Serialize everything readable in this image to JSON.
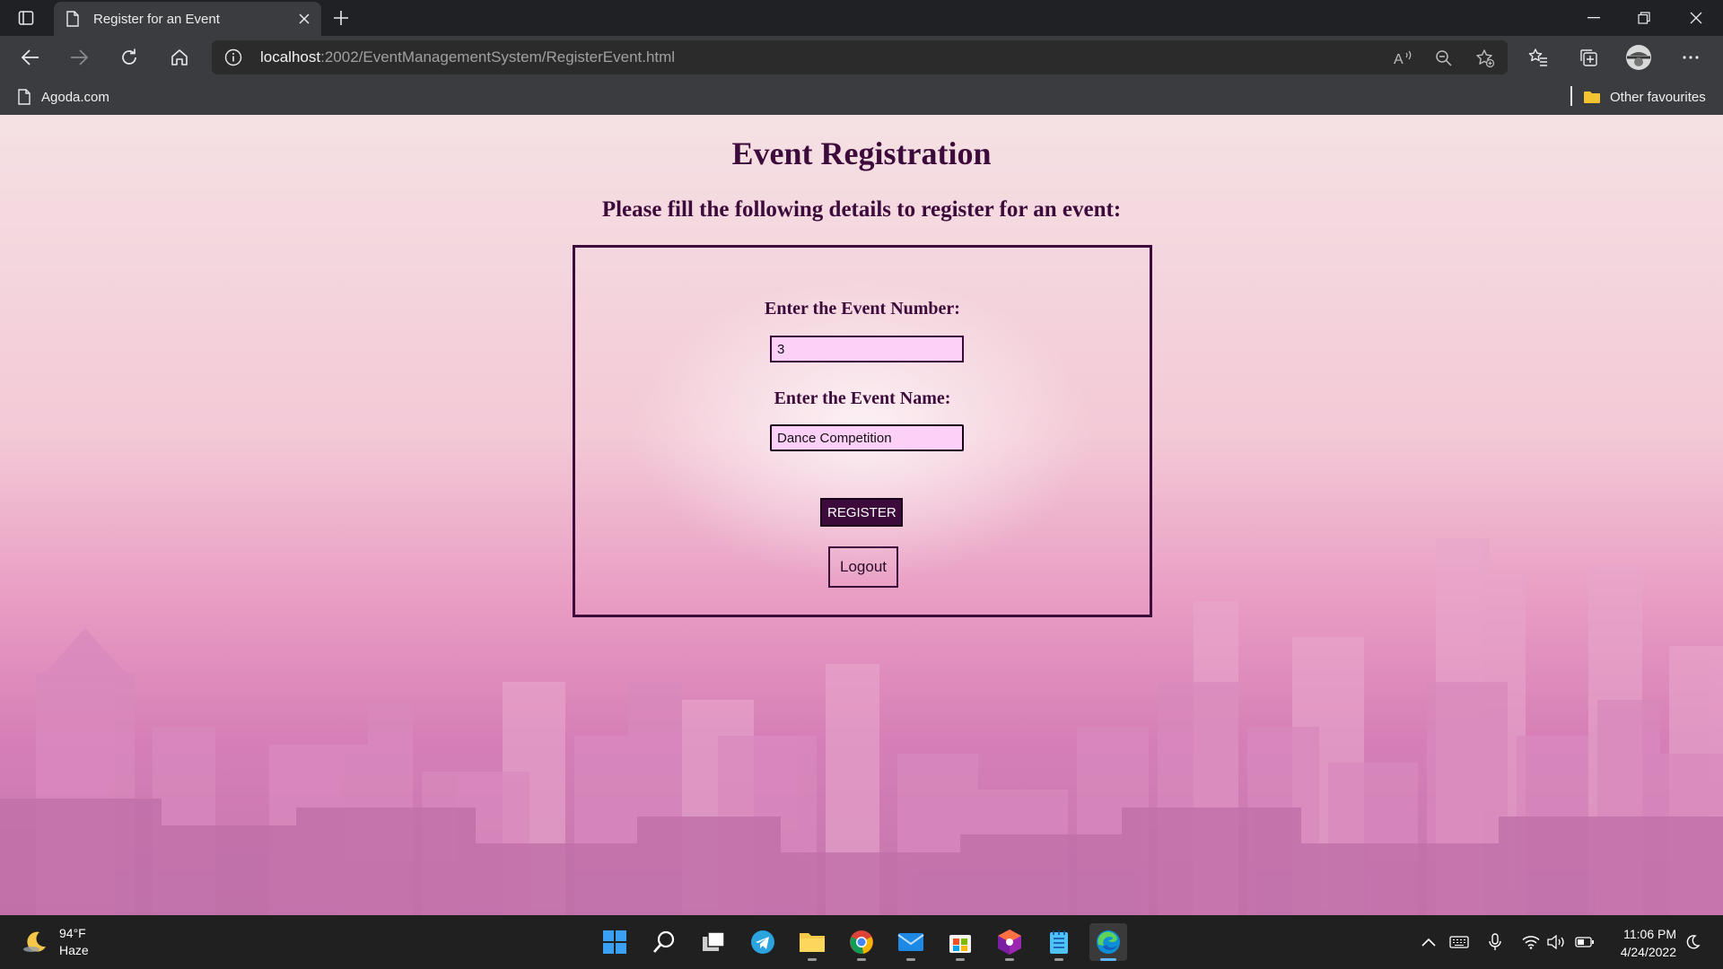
{
  "browser": {
    "tab_title": "Register for an Event",
    "url_host": "localhost",
    "url_path": ":2002/EventManagementSystem/RegisterEvent.html",
    "favorites": {
      "agoda": "Agoda.com",
      "other": "Other favourites"
    }
  },
  "page": {
    "title": "Event Registration",
    "subtitle": "Please fill the following details to register for an event:",
    "form": {
      "event_number_label": "Enter the Event Number:",
      "event_number_value": "3",
      "event_name_label": "Enter the Event Name:",
      "event_name_value": "Dance Competition",
      "register_label": "REGISTER",
      "logout_label": "Logout"
    }
  },
  "taskbar": {
    "weather_temp": "94°F",
    "weather_desc": "Haze",
    "time": "11:06 PM",
    "date": "4/24/2022"
  },
  "colors": {
    "heading": "#3d0b3b",
    "input_bg": "#fdd0f8",
    "register_bg": "#3d0b3b"
  }
}
